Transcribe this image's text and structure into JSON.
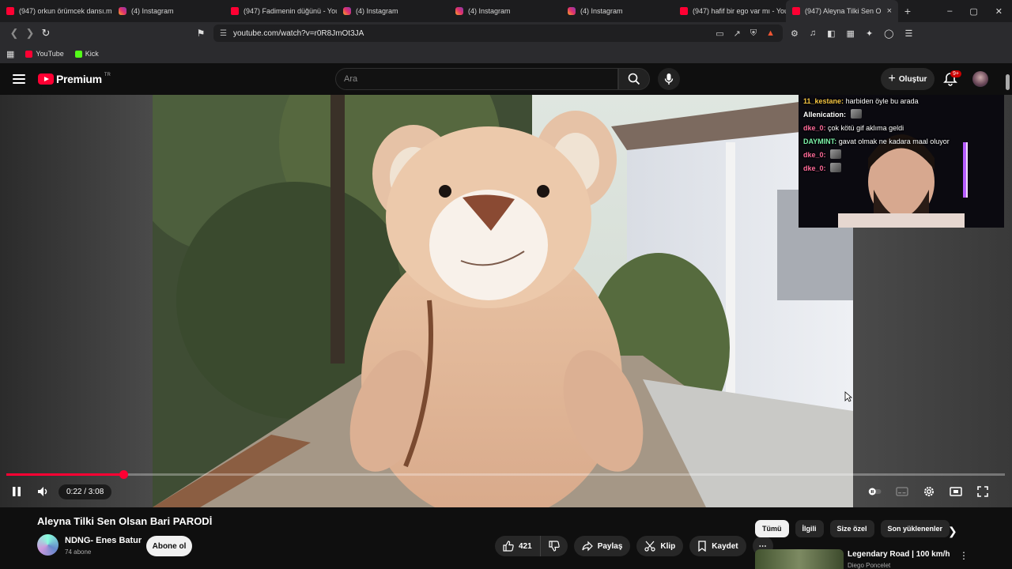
{
  "browser": {
    "tabs": [
      {
        "icon": "youtube-icon",
        "title": "(947) orkun örümcek dansı.mp",
        "active": false
      },
      {
        "icon": "instagram-icon",
        "title": "(4) Instagram",
        "active": false
      },
      {
        "icon": "youtube-icon",
        "title": "(947) Fadimenin düğünü - YouT",
        "active": false
      },
      {
        "icon": "instagram-icon",
        "title": "(4) Instagram",
        "active": false
      },
      {
        "icon": "instagram-icon",
        "title": "(4) Instagram",
        "active": false
      },
      {
        "icon": "instagram-icon",
        "title": "(4) Instagram",
        "active": false
      },
      {
        "icon": "youtube-icon",
        "title": "(947) hafif bir ego var mı - You",
        "active": false
      },
      {
        "icon": "youtube-icon",
        "title": "(947) Aleyna Tilki Sen O",
        "active": true
      }
    ],
    "new_tab": "+",
    "url": "youtube.com/watch?v=r0R8JmOt3JA",
    "bookmarks": [
      {
        "label": "YouTube",
        "icon": "youtube-icon"
      },
      {
        "label": "Kick",
        "icon": "kick-icon"
      }
    ]
  },
  "header": {
    "logo_text": "Premium",
    "logo_region": "TR",
    "search_placeholder": "Ara",
    "create_label": "Oluştur",
    "notification_count": "9+"
  },
  "chat": [
    {
      "user": "11_kestane:",
      "user_color": "#f5c542",
      "text": "harbiden öyle bu arada"
    },
    {
      "user": "Allenication:",
      "user_color": "#ffffff",
      "text": ""
    },
    {
      "user": "dke_0:",
      "user_color": "#ff6b9a",
      "text": "çok kötü gif aklıma geldi"
    },
    {
      "user": "DAYMINT:",
      "user_color": "#7cf2a8",
      "text": "gavat olmak ne kadara maal oluyor"
    },
    {
      "user": "dke_0:",
      "user_color": "#ff6b9a",
      "text": ""
    },
    {
      "user": "dke_0:",
      "user_color": "#ff6b9a",
      "text": ""
    }
  ],
  "player": {
    "time": "0:22 / 3:08",
    "progress": 0.117
  },
  "video": {
    "title": "Aleyna Tilki Sen Olsan Bari PARODİ",
    "channel": "NDNG- Enes Batur",
    "subscribers": "74 abone",
    "subscribe_label": "Abone ol",
    "likes": "421",
    "share_label": "Paylaş",
    "clip_label": "Klip",
    "save_label": "Kaydet"
  },
  "sidebar": {
    "chips": [
      "Tümü",
      "İlgili",
      "Size özel",
      "Son yüklenenler"
    ],
    "recommendation": {
      "title": "Legendary Road | 100 km/h",
      "channel": "Diego Poncelet"
    }
  }
}
